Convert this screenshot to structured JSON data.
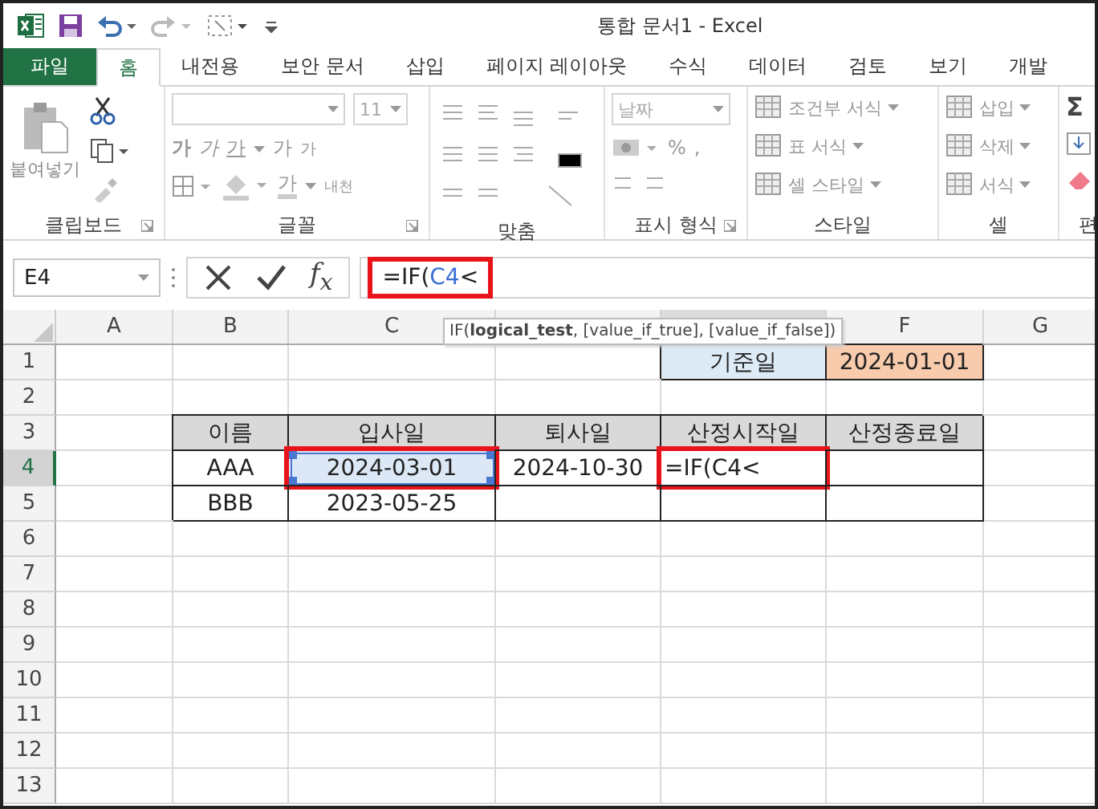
{
  "title_bar": {
    "title": "통합 문서1 - Excel"
  },
  "tabs": [
    {
      "label": "파일",
      "kind": "file",
      "selected": false
    },
    {
      "label": "홈",
      "kind": "tab",
      "selected": true
    },
    {
      "label": "내전용",
      "kind": "tab",
      "selected": false
    },
    {
      "label": "보안 문서",
      "kind": "tab",
      "selected": false
    },
    {
      "label": "삽입",
      "kind": "tab",
      "selected": false
    },
    {
      "label": "페이지 레이아웃",
      "kind": "tab",
      "selected": false
    },
    {
      "label": "수식",
      "kind": "tab",
      "selected": false
    },
    {
      "label": "데이터",
      "kind": "tab",
      "selected": false
    },
    {
      "label": "검토",
      "kind": "tab",
      "selected": false
    },
    {
      "label": "보기",
      "kind": "tab",
      "selected": false
    },
    {
      "label": "개발",
      "kind": "tab",
      "selected": false
    }
  ],
  "ribbon": {
    "groups": [
      {
        "kind": "clipboard",
        "label": "클립보드",
        "items": [
          "붙여넣기"
        ]
      },
      {
        "kind": "font",
        "label": "글꼴",
        "items": [
          "11",
          "가",
          "가",
          "가",
          "가",
          "가",
          "가",
          "내천"
        ]
      },
      {
        "kind": "alignment",
        "label": "맞춤"
      },
      {
        "kind": "number",
        "label": "표시 형식",
        "items": [
          "날짜",
          "%",
          ","
        ]
      },
      {
        "kind": "styles",
        "label": "스타일",
        "items": [
          "조건부 서식",
          "표 서식",
          "셀 스타일"
        ]
      },
      {
        "kind": "cells",
        "label": "셀",
        "items": [
          "삽입",
          "삭제",
          "서식"
        ]
      },
      {
        "kind": "editing",
        "label": "편",
        "items": [
          "Σ"
        ]
      }
    ]
  },
  "formula_bar": {
    "name_box": "E4",
    "function_button": "f$_{x}$",
    "outlined": true,
    "formula": [
      {
        "text": "=IF(",
        "ref": false
      },
      {
        "text": "C4",
        "ref": true
      },
      {
        "text": "<",
        "ref": false
      }
    ],
    "tooltip": "IF(**logical_test**, [value_if_true], [value_if_false])"
  },
  "grid": {
    "columns": [
      {
        "label": "A",
        "selected": false
      },
      {
        "label": "B",
        "selected": false
      },
      {
        "label": "C",
        "selected": false
      },
      {
        "selected": false
      },
      {
        "selected": true
      },
      {
        "label": "F",
        "selected": false
      },
      {
        "label": "G",
        "selected": false
      }
    ],
    "rows": [
      {
        "label": "1",
        "selected": false,
        "cells": [
          {},
          {},
          {},
          {},
          {
            "text": "기준일",
            "bordered": true,
            "color": "#ddebf7"
          },
          {
            "text": "2024-01-01",
            "bordered": true,
            "color": "#f8cbad"
          },
          {}
        ]
      },
      {
        "label": "2",
        "selected": false,
        "cells": [
          {},
          {},
          {},
          {},
          {},
          {},
          {}
        ]
      },
      {
        "label": "3",
        "selected": false,
        "cells": [
          {},
          {
            "text": "이름",
            "bordered": true,
            "color": "#d9d9d9"
          },
          {
            "text": "입사일",
            "bordered": true,
            "color": "#d9d9d9"
          },
          {
            "text": "퇴사일",
            "bordered": true,
            "color": "#d9d9d9"
          },
          {
            "text": "산정시작일",
            "bordered": true,
            "color": "#d9d9d9"
          },
          {
            "text": "산정종료일",
            "bordered": true,
            "color": "#d9d9d9"
          },
          {}
        ]
      },
      {
        "label": "4",
        "selected": true,
        "cells": [
          {},
          {
            "text": "AAA",
            "bordered": true
          },
          {
            "text": "2024-03-01",
            "bordered": true,
            "referenced": true,
            "outlined": true
          },
          {
            "text": "2024-10-30",
            "bordered": true
          },
          {
            "text": "=IF(C4<",
            "bordered": true,
            "editing": true,
            "outlined": true
          },
          {
            "bordered": true
          },
          {}
        ]
      },
      {
        "label": "5",
        "selected": false,
        "cells": [
          {},
          {
            "text": "BBB",
            "bordered": true
          },
          {
            "text": "2023-05-25",
            "bordered": true
          },
          {
            "bordered": true
          },
          {
            "bordered": true
          },
          {
            "bordered": true
          },
          {}
        ]
      },
      {
        "label": "6",
        "selected": false,
        "cells": [
          {},
          {},
          {},
          {},
          {},
          {},
          {}
        ]
      },
      {
        "label": "7",
        "selected": false,
        "cells": [
          {},
          {},
          {},
          {},
          {},
          {},
          {}
        ]
      },
      {
        "label": "8",
        "selected": false,
        "cells": [
          {},
          {},
          {},
          {},
          {},
          {},
          {}
        ]
      },
      {
        "label": "9",
        "selected": false,
        "cells": [
          {},
          {},
          {},
          {},
          {},
          {},
          {}
        ]
      },
      {
        "label": "10",
        "selected": false,
        "cells": [
          {},
          {},
          {},
          {},
          {},
          {},
          {}
        ]
      },
      {
        "label": "11",
        "selected": false,
        "cells": [
          {},
          {},
          {},
          {},
          {},
          {},
          {}
        ]
      },
      {
        "label": "12",
        "selected": false,
        "cells": [
          {},
          {},
          {},
          {},
          {},
          {},
          {}
        ]
      },
      {
        "label": "13",
        "selected": false,
        "cells": [
          {},
          {},
          {},
          {},
          {},
          {},
          {}
        ]
      }
    ]
  }
}
